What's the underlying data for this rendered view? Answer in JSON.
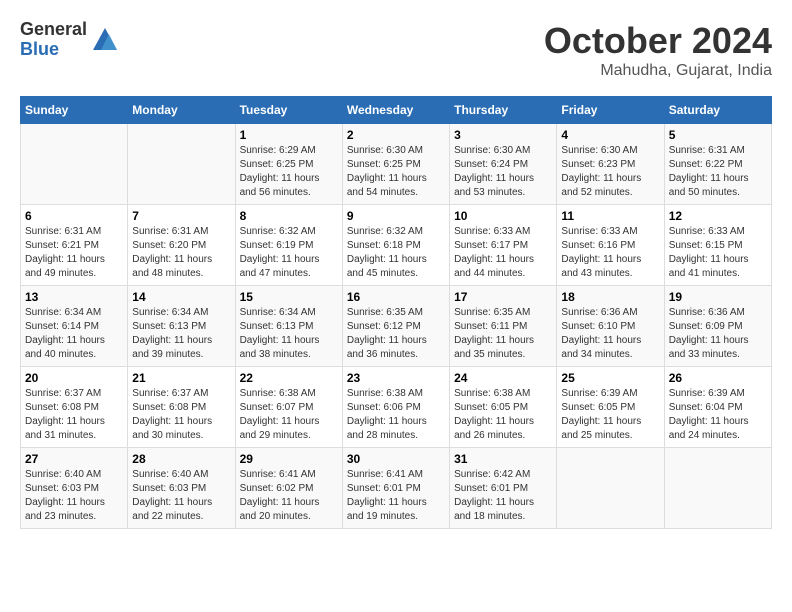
{
  "header": {
    "logo_general": "General",
    "logo_blue": "Blue",
    "month": "October 2024",
    "location": "Mahudha, Gujarat, India"
  },
  "weekdays": [
    "Sunday",
    "Monday",
    "Tuesday",
    "Wednesday",
    "Thursday",
    "Friday",
    "Saturday"
  ],
  "weeks": [
    [
      {
        "day": "",
        "sunrise": "",
        "sunset": "",
        "daylight": "",
        "empty": true
      },
      {
        "day": "",
        "sunrise": "",
        "sunset": "",
        "daylight": "",
        "empty": true
      },
      {
        "day": "1",
        "sunrise": "Sunrise: 6:29 AM",
        "sunset": "Sunset: 6:25 PM",
        "daylight": "Daylight: 11 hours and 56 minutes.",
        "empty": false
      },
      {
        "day": "2",
        "sunrise": "Sunrise: 6:30 AM",
        "sunset": "Sunset: 6:25 PM",
        "daylight": "Daylight: 11 hours and 54 minutes.",
        "empty": false
      },
      {
        "day": "3",
        "sunrise": "Sunrise: 6:30 AM",
        "sunset": "Sunset: 6:24 PM",
        "daylight": "Daylight: 11 hours and 53 minutes.",
        "empty": false
      },
      {
        "day": "4",
        "sunrise": "Sunrise: 6:30 AM",
        "sunset": "Sunset: 6:23 PM",
        "daylight": "Daylight: 11 hours and 52 minutes.",
        "empty": false
      },
      {
        "day": "5",
        "sunrise": "Sunrise: 6:31 AM",
        "sunset": "Sunset: 6:22 PM",
        "daylight": "Daylight: 11 hours and 50 minutes.",
        "empty": false
      }
    ],
    [
      {
        "day": "6",
        "sunrise": "Sunrise: 6:31 AM",
        "sunset": "Sunset: 6:21 PM",
        "daylight": "Daylight: 11 hours and 49 minutes.",
        "empty": false
      },
      {
        "day": "7",
        "sunrise": "Sunrise: 6:31 AM",
        "sunset": "Sunset: 6:20 PM",
        "daylight": "Daylight: 11 hours and 48 minutes.",
        "empty": false
      },
      {
        "day": "8",
        "sunrise": "Sunrise: 6:32 AM",
        "sunset": "Sunset: 6:19 PM",
        "daylight": "Daylight: 11 hours and 47 minutes.",
        "empty": false
      },
      {
        "day": "9",
        "sunrise": "Sunrise: 6:32 AM",
        "sunset": "Sunset: 6:18 PM",
        "daylight": "Daylight: 11 hours and 45 minutes.",
        "empty": false
      },
      {
        "day": "10",
        "sunrise": "Sunrise: 6:33 AM",
        "sunset": "Sunset: 6:17 PM",
        "daylight": "Daylight: 11 hours and 44 minutes.",
        "empty": false
      },
      {
        "day": "11",
        "sunrise": "Sunrise: 6:33 AM",
        "sunset": "Sunset: 6:16 PM",
        "daylight": "Daylight: 11 hours and 43 minutes.",
        "empty": false
      },
      {
        "day": "12",
        "sunrise": "Sunrise: 6:33 AM",
        "sunset": "Sunset: 6:15 PM",
        "daylight": "Daylight: 11 hours and 41 minutes.",
        "empty": false
      }
    ],
    [
      {
        "day": "13",
        "sunrise": "Sunrise: 6:34 AM",
        "sunset": "Sunset: 6:14 PM",
        "daylight": "Daylight: 11 hours and 40 minutes.",
        "empty": false
      },
      {
        "day": "14",
        "sunrise": "Sunrise: 6:34 AM",
        "sunset": "Sunset: 6:13 PM",
        "daylight": "Daylight: 11 hours and 39 minutes.",
        "empty": false
      },
      {
        "day": "15",
        "sunrise": "Sunrise: 6:34 AM",
        "sunset": "Sunset: 6:13 PM",
        "daylight": "Daylight: 11 hours and 38 minutes.",
        "empty": false
      },
      {
        "day": "16",
        "sunrise": "Sunrise: 6:35 AM",
        "sunset": "Sunset: 6:12 PM",
        "daylight": "Daylight: 11 hours and 36 minutes.",
        "empty": false
      },
      {
        "day": "17",
        "sunrise": "Sunrise: 6:35 AM",
        "sunset": "Sunset: 6:11 PM",
        "daylight": "Daylight: 11 hours and 35 minutes.",
        "empty": false
      },
      {
        "day": "18",
        "sunrise": "Sunrise: 6:36 AM",
        "sunset": "Sunset: 6:10 PM",
        "daylight": "Daylight: 11 hours and 34 minutes.",
        "empty": false
      },
      {
        "day": "19",
        "sunrise": "Sunrise: 6:36 AM",
        "sunset": "Sunset: 6:09 PM",
        "daylight": "Daylight: 11 hours and 33 minutes.",
        "empty": false
      }
    ],
    [
      {
        "day": "20",
        "sunrise": "Sunrise: 6:37 AM",
        "sunset": "Sunset: 6:08 PM",
        "daylight": "Daylight: 11 hours and 31 minutes.",
        "empty": false
      },
      {
        "day": "21",
        "sunrise": "Sunrise: 6:37 AM",
        "sunset": "Sunset: 6:08 PM",
        "daylight": "Daylight: 11 hours and 30 minutes.",
        "empty": false
      },
      {
        "day": "22",
        "sunrise": "Sunrise: 6:38 AM",
        "sunset": "Sunset: 6:07 PM",
        "daylight": "Daylight: 11 hours and 29 minutes.",
        "empty": false
      },
      {
        "day": "23",
        "sunrise": "Sunrise: 6:38 AM",
        "sunset": "Sunset: 6:06 PM",
        "daylight": "Daylight: 11 hours and 28 minutes.",
        "empty": false
      },
      {
        "day": "24",
        "sunrise": "Sunrise: 6:38 AM",
        "sunset": "Sunset: 6:05 PM",
        "daylight": "Daylight: 11 hours and 26 minutes.",
        "empty": false
      },
      {
        "day": "25",
        "sunrise": "Sunrise: 6:39 AM",
        "sunset": "Sunset: 6:05 PM",
        "daylight": "Daylight: 11 hours and 25 minutes.",
        "empty": false
      },
      {
        "day": "26",
        "sunrise": "Sunrise: 6:39 AM",
        "sunset": "Sunset: 6:04 PM",
        "daylight": "Daylight: 11 hours and 24 minutes.",
        "empty": false
      }
    ],
    [
      {
        "day": "27",
        "sunrise": "Sunrise: 6:40 AM",
        "sunset": "Sunset: 6:03 PM",
        "daylight": "Daylight: 11 hours and 23 minutes.",
        "empty": false
      },
      {
        "day": "28",
        "sunrise": "Sunrise: 6:40 AM",
        "sunset": "Sunset: 6:03 PM",
        "daylight": "Daylight: 11 hours and 22 minutes.",
        "empty": false
      },
      {
        "day": "29",
        "sunrise": "Sunrise: 6:41 AM",
        "sunset": "Sunset: 6:02 PM",
        "daylight": "Daylight: 11 hours and 20 minutes.",
        "empty": false
      },
      {
        "day": "30",
        "sunrise": "Sunrise: 6:41 AM",
        "sunset": "Sunset: 6:01 PM",
        "daylight": "Daylight: 11 hours and 19 minutes.",
        "empty": false
      },
      {
        "day": "31",
        "sunrise": "Sunrise: 6:42 AM",
        "sunset": "Sunset: 6:01 PM",
        "daylight": "Daylight: 11 hours and 18 minutes.",
        "empty": false
      },
      {
        "day": "",
        "sunrise": "",
        "sunset": "",
        "daylight": "",
        "empty": true
      },
      {
        "day": "",
        "sunrise": "",
        "sunset": "",
        "daylight": "",
        "empty": true
      }
    ]
  ]
}
